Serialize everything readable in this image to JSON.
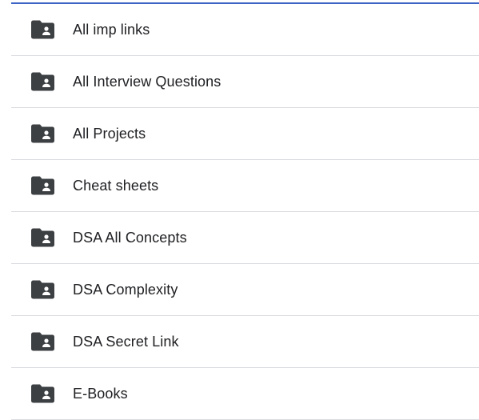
{
  "folders": [
    {
      "name": "All imp links",
      "icon": "shared-folder-icon"
    },
    {
      "name": "All Interview Questions",
      "icon": "shared-folder-icon"
    },
    {
      "name": "All Projects",
      "icon": "shared-folder-icon"
    },
    {
      "name": "Cheat sheets",
      "icon": "shared-folder-icon"
    },
    {
      "name": "DSA All Concepts",
      "icon": "shared-folder-icon"
    },
    {
      "name": "DSA Complexity",
      "icon": "shared-folder-icon"
    },
    {
      "name": "DSA Secret Link",
      "icon": "shared-folder-icon"
    },
    {
      "name": "E-Books",
      "icon": "shared-folder-icon"
    }
  ],
  "colors": {
    "icon": "#3c4043",
    "text": "#202124",
    "divider": "#dadce0",
    "accent_line": "#3c64c4"
  }
}
